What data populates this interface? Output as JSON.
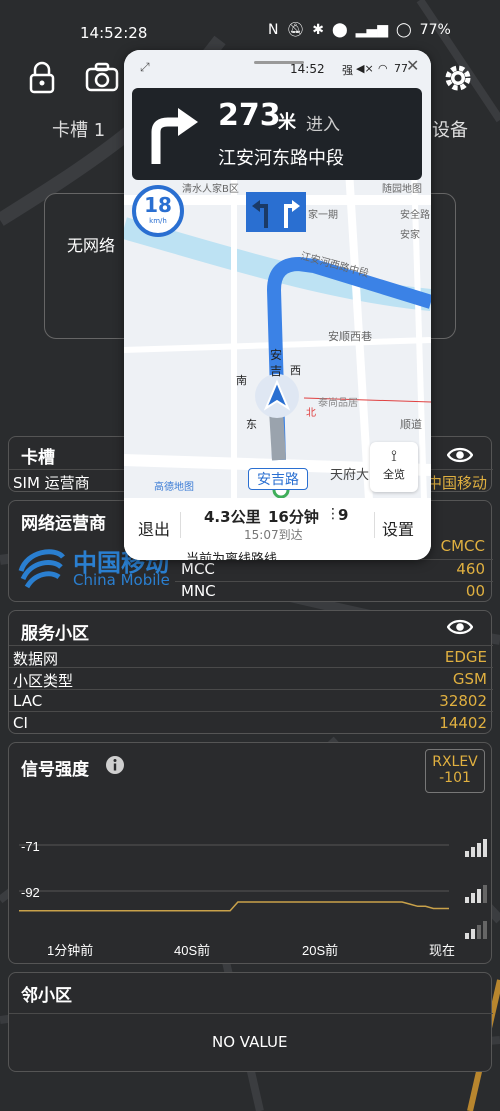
{
  "status_bar": {
    "time": "14:52:28",
    "battery": "77%"
  },
  "top_tabs": {
    "left": "卡槽 1",
    "right": "设备"
  },
  "sim_card_label": "无网络",
  "overlay": {
    "mini_time": "14:52",
    "mini_signal": "强",
    "mini_battery": "77",
    "distance_num": "273",
    "distance_unit": "米",
    "enter_label": "进入",
    "road_name": "江安河东路中段",
    "speed_limit": "18",
    "speed_unit": "km/h",
    "map_labels": {
      "l1": "清水人家B区",
      "l2": "随园地图",
      "l3": "安全路",
      "l4": "家一期",
      "l5": "江安河西路中段",
      "l6": "安顺西巷",
      "l7": "顺道",
      "l8": "南",
      "l9": "西",
      "l10": "东",
      "l11": "北",
      "l12": "安",
      "l13": "吉",
      "l14": "天府大",
      "l15": "泰尚品居",
      "l16": "安家",
      "l17": "高德地图"
    },
    "road_tag": "安吉路",
    "overview_label": "全览",
    "exit_label": "退出",
    "trip_distance": "4.3公里",
    "trip_time": "16分钟",
    "traffic_lights": "9",
    "arrival": "15:07到达",
    "settings_label": "设置",
    "offline_notice": "当前为离线路线"
  },
  "slot_panel": {
    "title": "卡槽",
    "rows": [
      {
        "k": "SIM 运营商",
        "v": "中国移动"
      }
    ]
  },
  "operator_panel": {
    "title": "网络运营商",
    "logo_cn": "中国移动",
    "logo_en": "China Mobile",
    "rows": [
      {
        "k": "",
        "v": "CMCC"
      },
      {
        "k": "MCC",
        "v": "460"
      },
      {
        "k": "MNC",
        "v": "00"
      }
    ]
  },
  "cell_panel": {
    "title": "服务小区",
    "rows": [
      {
        "k": "数据网",
        "v": "EDGE"
      },
      {
        "k": "小区类型",
        "v": "GSM"
      },
      {
        "k": "LAC",
        "v": "32802"
      },
      {
        "k": "CI",
        "v": "14402"
      }
    ]
  },
  "signal_panel": {
    "title": "信号强度",
    "badge_line1": "RXLEV",
    "badge_line2": "-101"
  },
  "chart_data": {
    "type": "line",
    "title": "信号强度",
    "y_ticks": [
      "-71",
      "-92"
    ],
    "x_ticks": [
      "1分钟前",
      "40S前",
      "20S前",
      "现在"
    ],
    "ylim": [
      -112,
      -71
    ],
    "series": [
      {
        "values": [
          -101,
          -101,
          -101,
          -101,
          -101,
          -101,
          -101,
          -101,
          -101,
          -101,
          -101,
          -101,
          -101,
          -101,
          -101,
          -101,
          -101,
          -101,
          -101,
          -101,
          -101,
          -101,
          -101,
          -101,
          -101,
          -101,
          -101,
          -101,
          -97,
          -97,
          -97,
          -97,
          -97,
          -97,
          -97,
          -97,
          -97,
          -97,
          -97,
          -97,
          -97,
          -97,
          -97,
          -97,
          -97,
          -97,
          -97,
          -97,
          -97,
          -97,
          -98,
          -99,
          -99,
          -100,
          -100,
          -100
        ]
      }
    ],
    "colors": {
      "line": "#c9a24a",
      "grid": "#555555"
    }
  },
  "neighbor_panel": {
    "title": "邻小区",
    "empty": "NO VALUE"
  }
}
